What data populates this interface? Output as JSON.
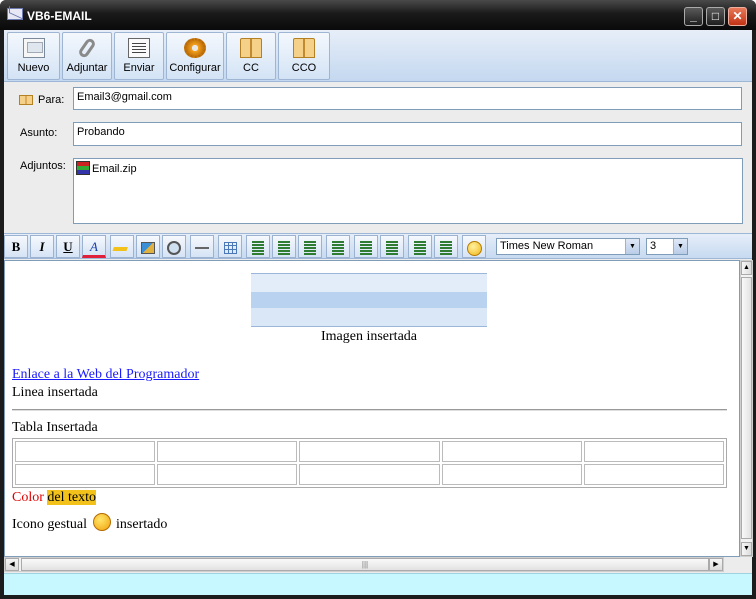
{
  "window": {
    "title": "VB6-EMAIL",
    "min_glyph": "_",
    "max_glyph": "□",
    "close_glyph": "✕"
  },
  "toolbar": {
    "buttons": [
      {
        "label": "Nuevo",
        "icon": "new-message-icon"
      },
      {
        "label": "Adjuntar",
        "icon": "paperclip-icon"
      },
      {
        "label": "Enviar",
        "icon": "send-document-icon"
      },
      {
        "label": "Configurar",
        "icon": "gear-icon"
      },
      {
        "label": "CC",
        "icon": "address-book-icon"
      },
      {
        "label": "CCO",
        "icon": "address-book-icon"
      }
    ]
  },
  "form": {
    "to_label": "Para:",
    "to_value": "Email3@gmail.com",
    "subject_label": "Asunto:",
    "subject_value": "Probando",
    "attachments_label": "Adjuntos:",
    "attachments": [
      "Email.zip"
    ]
  },
  "format": {
    "bold": "B",
    "italic": "I",
    "underline": "U",
    "font_color": "A",
    "font_name": "Times New Roman",
    "font_size": "3",
    "arrow": "▼"
  },
  "editor": {
    "image_caption": "Imagen insertada",
    "link_text": "Enlace a la Web del Programador",
    "line_text": "Linea insertada",
    "table_title": "Tabla Insertada",
    "table_rows": 2,
    "table_cols": 5,
    "color_word": "Color",
    "highlight_text": "del texto",
    "icon_before": "Icono gestual",
    "icon_after": "insertado",
    "colors": {
      "red": "#e00000",
      "highlight": "#f2c21b",
      "link": "#1a1aff"
    }
  },
  "scrollbar": {
    "up": "▲",
    "down": "▼",
    "left": "◀",
    "right": "▶",
    "grip": "|||"
  }
}
